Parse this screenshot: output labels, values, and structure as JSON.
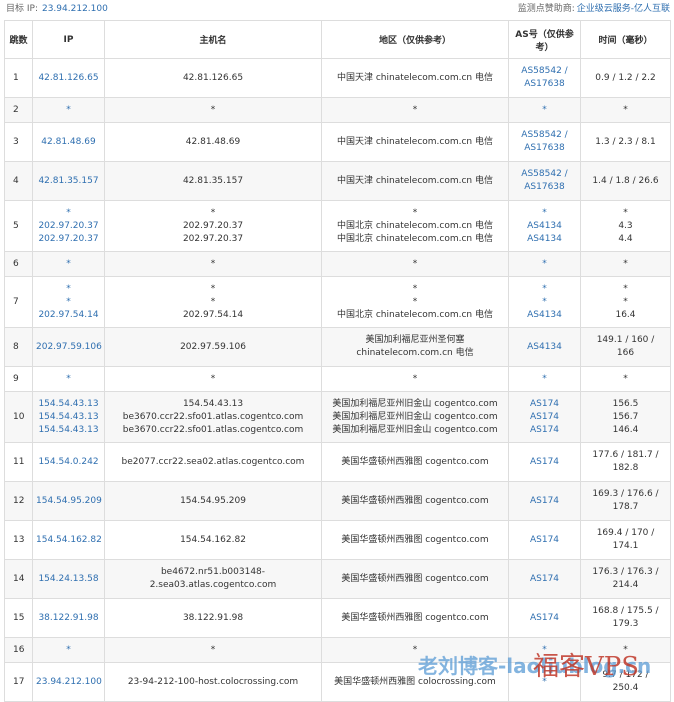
{
  "header": {
    "target_label": "目标 IP:",
    "target_ip": "23.94.212.100",
    "sponsor_label": "监测点赞助商:",
    "sponsor": "企业级云服务-亿人互联"
  },
  "columns": [
    "跳数",
    "IP",
    "主机名",
    "地区（仅供参考）",
    "AS号（仅供参考）",
    "时间（毫秒）"
  ],
  "rows": [
    {
      "hop": "1",
      "ip": [
        "42.81.126.65"
      ],
      "host": [
        "42.81.126.65"
      ],
      "region": [
        "中国天津 chinatelecom.com.cn 电信"
      ],
      "as": [
        "AS58542 /",
        "AS17638"
      ],
      "time": [
        "0.9 / 1.2 / 2.2"
      ]
    },
    {
      "hop": "2",
      "ip": [
        "*"
      ],
      "host": [
        "*"
      ],
      "region": [
        "*"
      ],
      "as": [
        "*"
      ],
      "time": [
        "*"
      ]
    },
    {
      "hop": "3",
      "ip": [
        "42.81.48.69"
      ],
      "host": [
        "42.81.48.69"
      ],
      "region": [
        "中国天津 chinatelecom.com.cn 电信"
      ],
      "as": [
        "AS58542 /",
        "AS17638"
      ],
      "time": [
        "1.3 / 2.3 / 8.1"
      ]
    },
    {
      "hop": "4",
      "ip": [
        "42.81.35.157"
      ],
      "host": [
        "42.81.35.157"
      ],
      "region": [
        "中国天津 chinatelecom.com.cn 电信"
      ],
      "as": [
        "AS58542 /",
        "AS17638"
      ],
      "time": [
        "1.4 / 1.8 / 26.6"
      ]
    },
    {
      "hop": "5",
      "ip": [
        "*",
        "202.97.20.37",
        "202.97.20.37"
      ],
      "host": [
        "*",
        "202.97.20.37",
        "202.97.20.37"
      ],
      "region": [
        "*",
        "中国北京 chinatelecom.com.cn 电信",
        "中国北京 chinatelecom.com.cn 电信"
      ],
      "as": [
        "*",
        "AS4134",
        "AS4134"
      ],
      "time": [
        "*",
        "4.3",
        "4.4"
      ]
    },
    {
      "hop": "6",
      "ip": [
        "*"
      ],
      "host": [
        "*"
      ],
      "region": [
        "*"
      ],
      "as": [
        "*"
      ],
      "time": [
        "*"
      ]
    },
    {
      "hop": "7",
      "ip": [
        "*",
        "*",
        "202.97.54.14"
      ],
      "host": [
        "*",
        "*",
        "202.97.54.14"
      ],
      "region": [
        "*",
        "*",
        "中国北京 chinatelecom.com.cn 电信"
      ],
      "as": [
        "*",
        "*",
        "AS4134"
      ],
      "time": [
        "*",
        "*",
        "16.4"
      ]
    },
    {
      "hop": "8",
      "ip": [
        "202.97.59.106"
      ],
      "host": [
        "202.97.59.106"
      ],
      "region": [
        "美国加利福尼亚州圣何塞",
        "chinatelecom.com.cn 电信"
      ],
      "as": [
        "AS4134"
      ],
      "time": [
        "149.1 / 160 /",
        "166"
      ]
    },
    {
      "hop": "9",
      "ip": [
        "*"
      ],
      "host": [
        "*"
      ],
      "region": [
        "*"
      ],
      "as": [
        "*"
      ],
      "time": [
        "*"
      ]
    },
    {
      "hop": "10",
      "ip": [
        "154.54.43.13",
        "154.54.43.13",
        "154.54.43.13"
      ],
      "host": [
        "154.54.43.13",
        "be3670.ccr22.sfo01.atlas.cogentco.com",
        "be3670.ccr22.sfo01.atlas.cogentco.com"
      ],
      "region": [
        "美国加利福尼亚州旧金山 cogentco.com",
        "美国加利福尼亚州旧金山 cogentco.com",
        "美国加利福尼亚州旧金山 cogentco.com"
      ],
      "as": [
        "AS174",
        "AS174",
        "AS174"
      ],
      "time": [
        "156.5",
        "156.7",
        "146.4"
      ]
    },
    {
      "hop": "11",
      "ip": [
        "154.54.0.242"
      ],
      "host": [
        "be2077.ccr22.sea02.atlas.cogentco.com"
      ],
      "region": [
        "美国华盛顿州西雅图 cogentco.com"
      ],
      "as": [
        "AS174"
      ],
      "time": [
        "177.6 / 181.7 /",
        "182.8"
      ]
    },
    {
      "hop": "12",
      "ip": [
        "154.54.95.209"
      ],
      "host": [
        "154.54.95.209"
      ],
      "region": [
        "美国华盛顿州西雅图 cogentco.com"
      ],
      "as": [
        "AS174"
      ],
      "time": [
        "169.3 / 176.6 /",
        "178.7"
      ]
    },
    {
      "hop": "13",
      "ip": [
        "154.54.162.82"
      ],
      "host": [
        "154.54.162.82"
      ],
      "region": [
        "美国华盛顿州西雅图 cogentco.com"
      ],
      "as": [
        "AS174"
      ],
      "time": [
        "169.4 / 170 /",
        "174.1"
      ]
    },
    {
      "hop": "14",
      "ip": [
        "154.24.13.58"
      ],
      "host": [
        "be4672.nr51.b003148-",
        "2.sea03.atlas.cogentco.com"
      ],
      "region": [
        "美国华盛顿州西雅图 cogentco.com"
      ],
      "as": [
        "AS174"
      ],
      "time": [
        "176.3 / 176.3 /",
        "214.4"
      ]
    },
    {
      "hop": "15",
      "ip": [
        "38.122.91.98"
      ],
      "host": [
        "38.122.91.98"
      ],
      "region": [
        "美国华盛顿州西雅图 cogentco.com"
      ],
      "as": [
        "AS174"
      ],
      "time": [
        "168.8 / 175.5 /",
        "179.3"
      ]
    },
    {
      "hop": "16",
      "ip": [
        "*"
      ],
      "host": [
        "*"
      ],
      "region": [
        "*"
      ],
      "as": [
        "*"
      ],
      "time": [
        "*"
      ]
    },
    {
      "hop": "17",
      "ip": [
        "23.94.212.100"
      ],
      "host": [
        "23-94-212-100-host.colocrossing.com"
      ],
      "region": [
        "美国华盛顿州西雅图 colocrossing.com"
      ],
      "as": [
        "*"
      ],
      "time": [
        "9.7 / 172 /",
        "250.4"
      ]
    }
  ],
  "watermark": {
    "text": "老刘博客-laoliublog.cn",
    "logo": "福客VPS"
  }
}
